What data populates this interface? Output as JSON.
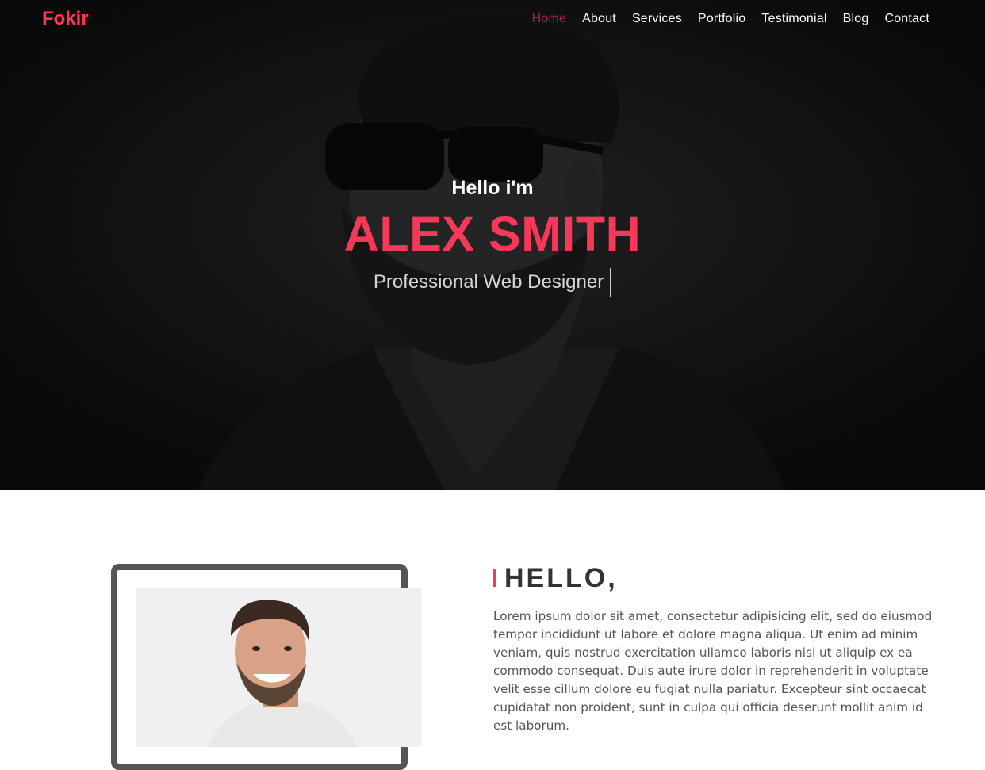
{
  "brand": {
    "logo": "Fokir",
    "accent_color": "#f73859"
  },
  "nav": {
    "items": [
      {
        "label": "Home",
        "active": true
      },
      {
        "label": "About",
        "active": false
      },
      {
        "label": "Services",
        "active": false
      },
      {
        "label": "Portfolio",
        "active": false
      },
      {
        "label": "Testimonial",
        "active": false
      },
      {
        "label": "Blog",
        "active": false
      },
      {
        "label": "Contact",
        "active": false
      }
    ]
  },
  "hero": {
    "greeting": "Hello i'm",
    "name": "ALEX SMITH",
    "role": "Professional Web Designer"
  },
  "about": {
    "heading": "HELLO,",
    "paragraph": "Lorem ipsum dolor sit amet, consectetur adipisicing elit, sed do eiusmod tempor incididunt ut labore et dolore magna aliqua. Ut enim ad minim veniam, quis nostrud exercitation ullamco laboris nisi ut aliquip ex ea commodo consequat. Duis aute irure dolor in reprehenderit in voluptate velit esse cillum dolore eu fugiat nulla pariatur. Excepteur sint occaecat cupidatat non proident, sunt in culpa qui officia deserunt mollit anim id est laborum."
  }
}
